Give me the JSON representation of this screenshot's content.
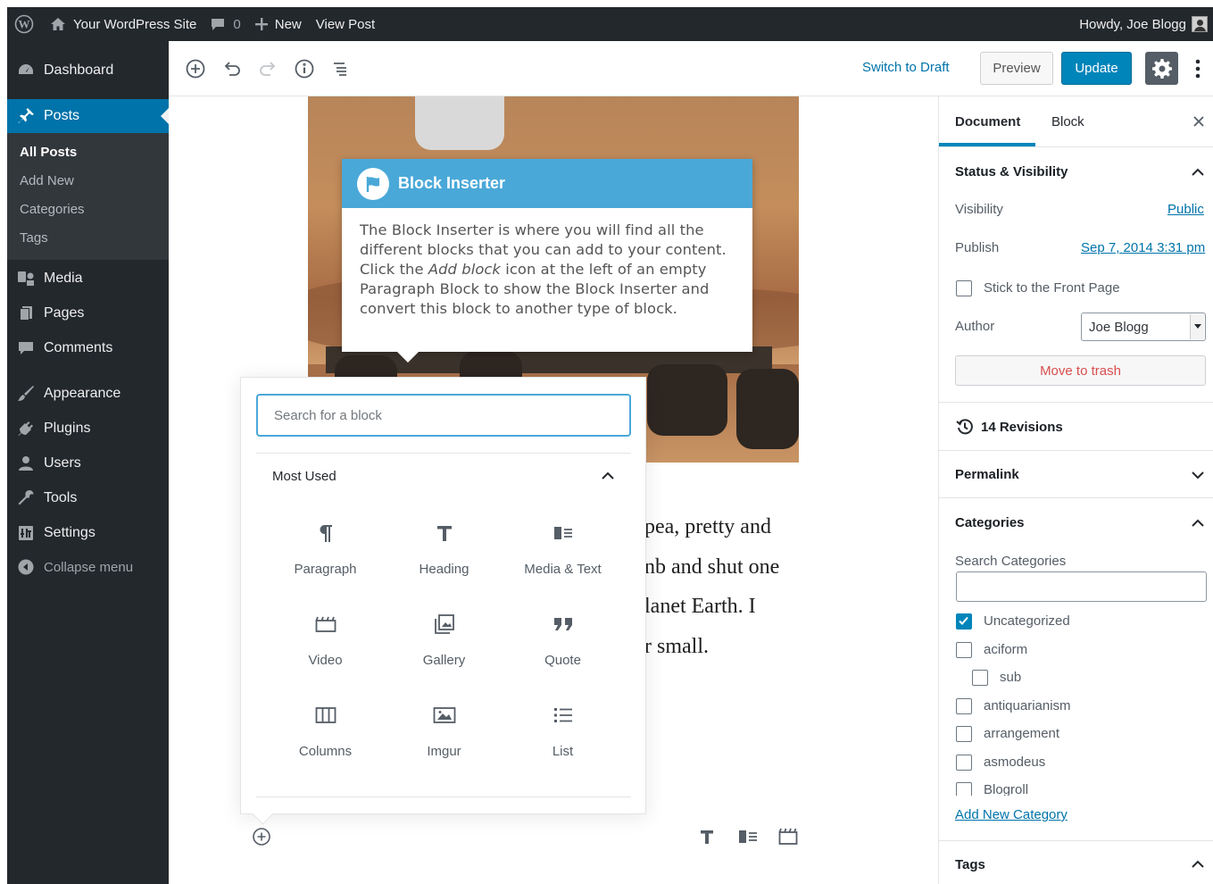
{
  "adminbar": {
    "site_name": "Your WordPress Site",
    "comments_count": "0",
    "new_label": "New",
    "view_post": "View Post",
    "howdy": "Howdy, Joe Blogg"
  },
  "menu": {
    "dashboard": "Dashboard",
    "posts": "Posts",
    "posts_sub": [
      "All Posts",
      "Add New",
      "Categories",
      "Tags"
    ],
    "media": "Media",
    "pages": "Pages",
    "comments": "Comments",
    "appearance": "Appearance",
    "plugins": "Plugins",
    "users": "Users",
    "tools": "Tools",
    "settings": "Settings",
    "collapse": "Collapse menu"
  },
  "header": {
    "switch_to_draft": "Switch to Draft",
    "preview": "Preview",
    "update": "Update"
  },
  "post": {
    "lines": [
      "pea, pretty and",
      "nb and shut one",
      "lanet Earth. I",
      "r small."
    ]
  },
  "tooltip": {
    "title": "Block Inserter",
    "body_before": "The Block Inserter is where you will find all the different blocks that you can add to your content. Click the ",
    "body_em": "Add block",
    "body_after": " icon at the left of an empty Paragraph Block to show the Block Inserter and convert this block to another type of block."
  },
  "inserter": {
    "search_placeholder": "Search for a block",
    "section_title": "Most Used",
    "blocks": [
      {
        "label": "Paragraph",
        "icon": "paragraph-icon"
      },
      {
        "label": "Heading",
        "icon": "heading-icon"
      },
      {
        "label": "Media & Text",
        "icon": "media-text-icon"
      },
      {
        "label": "Video",
        "icon": "video-icon"
      },
      {
        "label": "Gallery",
        "icon": "gallery-icon"
      },
      {
        "label": "Quote",
        "icon": "quote-icon"
      },
      {
        "label": "Columns",
        "icon": "columns-icon"
      },
      {
        "label": "Imgur",
        "icon": "imgur-icon"
      },
      {
        "label": "List",
        "icon": "list-icon"
      }
    ]
  },
  "sidebar": {
    "tab_document": "Document",
    "tab_block": "Block",
    "status_title": "Status & Visibility",
    "visibility_label": "Visibility",
    "visibility_value": "Public",
    "publish_label": "Publish",
    "publish_value": "Sep 7, 2014 3:31 pm",
    "sticky_label": "Stick to the Front Page",
    "author_label": "Author",
    "author_value": "Joe Blogg",
    "trash": "Move to trash",
    "revisions": "14 Revisions",
    "permalink": "Permalink",
    "categories_title": "Categories",
    "search_categories": "Search Categories",
    "categories": [
      {
        "label": "Uncategorized",
        "checked": true
      },
      {
        "label": "aciform",
        "checked": false
      },
      {
        "label": "sub",
        "checked": false
      },
      {
        "label": "antiquarianism",
        "checked": false
      },
      {
        "label": "arrangement",
        "checked": false
      },
      {
        "label": "asmodeus",
        "checked": false
      },
      {
        "label": "Blogroll",
        "checked": false
      }
    ],
    "add_new_category": "Add New Category",
    "tags_title": "Tags"
  },
  "colors": {
    "admin_bar": "#23282d",
    "accent": "#0073aa",
    "tooltip_header": "#4aa8d8",
    "update_button": "#0085ba"
  }
}
